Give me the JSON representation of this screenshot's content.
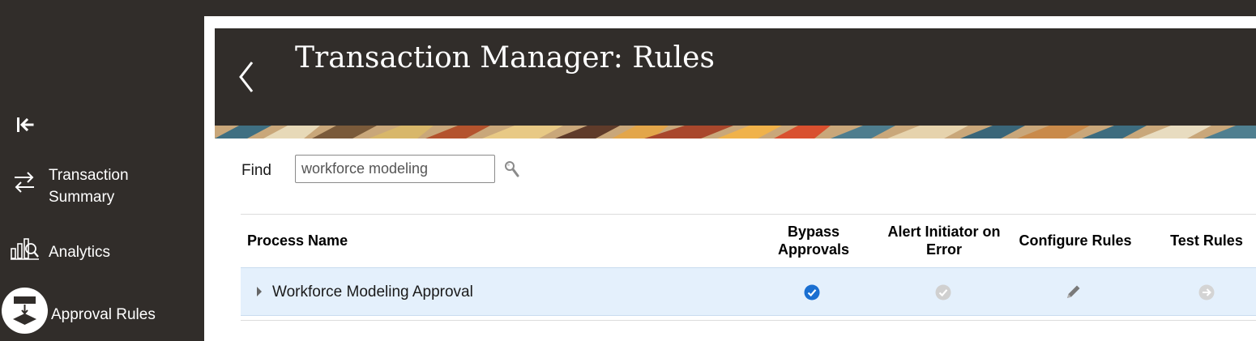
{
  "sidebar": {
    "collapse_icon": "collapse-left-icon",
    "items": [
      {
        "label": "Transaction Summary",
        "icon": "swap-arrows-icon"
      },
      {
        "label": "Analytics",
        "icon": "analytics-icon"
      },
      {
        "label": "Approval Rules",
        "icon": "approval-rules-icon",
        "active": true
      }
    ]
  },
  "header": {
    "title": "Transaction Manager: Rules",
    "back_icon": "chevron-left-icon"
  },
  "search": {
    "label": "Find",
    "value": "workforce modeling",
    "icon": "search-icon"
  },
  "table": {
    "columns": {
      "process_name": "Process Name",
      "bypass_approvals": "Bypass Approvals",
      "alert_initiator": "Alert Initiator on Error",
      "configure_rules": "Configure Rules",
      "test_rules": "Test Rules"
    },
    "rows": [
      {
        "process_name": "Workforce Modeling Approval",
        "bypass_approvals": true,
        "alert_initiator_on_error": false,
        "configure_icon": "pencil-icon",
        "test_icon": "arrow-right-circle-icon"
      }
    ]
  },
  "colors": {
    "sidebar_bg": "#312d2a",
    "banner_bg": "#312d2a",
    "row_selected_bg": "#e4f0fc",
    "check_active": "#1a6fd1",
    "check_inactive": "#d0d0d0"
  }
}
